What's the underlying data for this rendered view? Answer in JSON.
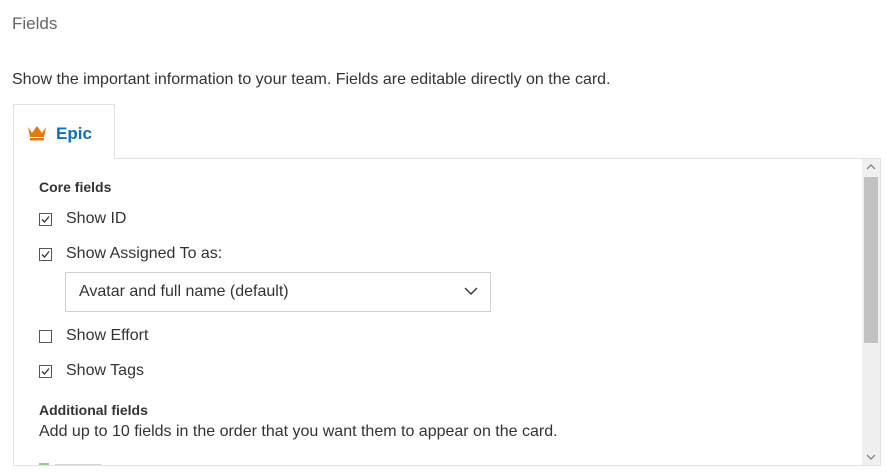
{
  "header": {
    "title": "Fields",
    "description": "Show the important information to your team. Fields are editable directly on the card."
  },
  "tabs": [
    {
      "label": "Epic",
      "icon": "crown-icon",
      "selected": true
    }
  ],
  "core": {
    "heading": "Core fields",
    "fields": [
      {
        "label": "Show ID",
        "checked": true
      },
      {
        "label": "Show Assigned To as:",
        "checked": true
      },
      {
        "label": "Show Effort",
        "checked": false
      },
      {
        "label": "Show Tags",
        "checked": true
      }
    ],
    "assigned_display": {
      "value": "Avatar and full name (default)"
    }
  },
  "additional": {
    "heading": "Additional fields",
    "description": "Add up to 10 fields in the order that you want them to appear on the card."
  },
  "colors": {
    "accent": "#106ebe",
    "crown": "#e07a10",
    "text": "#333333",
    "muted": "#666666"
  }
}
